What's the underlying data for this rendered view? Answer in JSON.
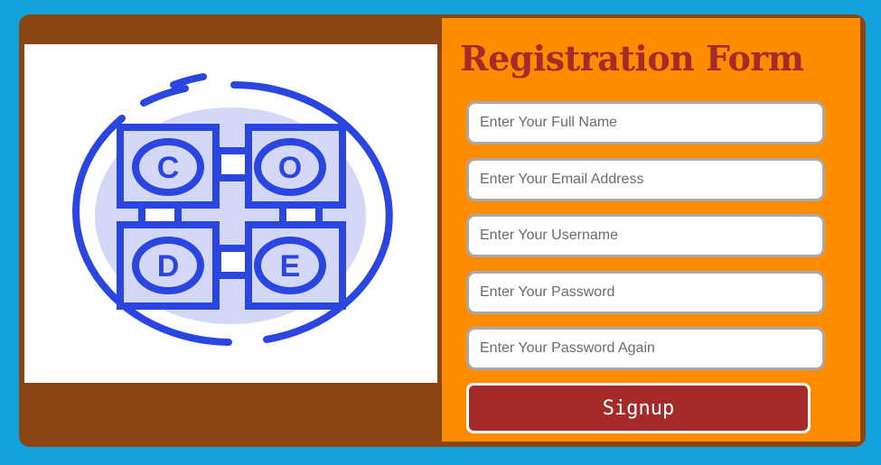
{
  "colors": {
    "background": "#12a3dc",
    "card": "#8b4513",
    "form_panel": "#ff8c00",
    "title": "#a52a2a",
    "button": "#a52a2a",
    "logo_stroke": "#2b46e0",
    "logo_fill": "#d4d8f7"
  },
  "logo": {
    "icon": "code-logo-icon",
    "letters": [
      "C",
      "O",
      "D",
      "E"
    ]
  },
  "form": {
    "title": "Registration Form",
    "fields": [
      {
        "placeholder": "Enter Your Full Name",
        "type": "text"
      },
      {
        "placeholder": "Enter Your Email Address",
        "type": "email"
      },
      {
        "placeholder": "Enter Your Username",
        "type": "text"
      },
      {
        "placeholder": "Enter Your Password",
        "type": "password"
      },
      {
        "placeholder": "Enter Your Password Again",
        "type": "password"
      }
    ],
    "signup_label": "Signup"
  }
}
